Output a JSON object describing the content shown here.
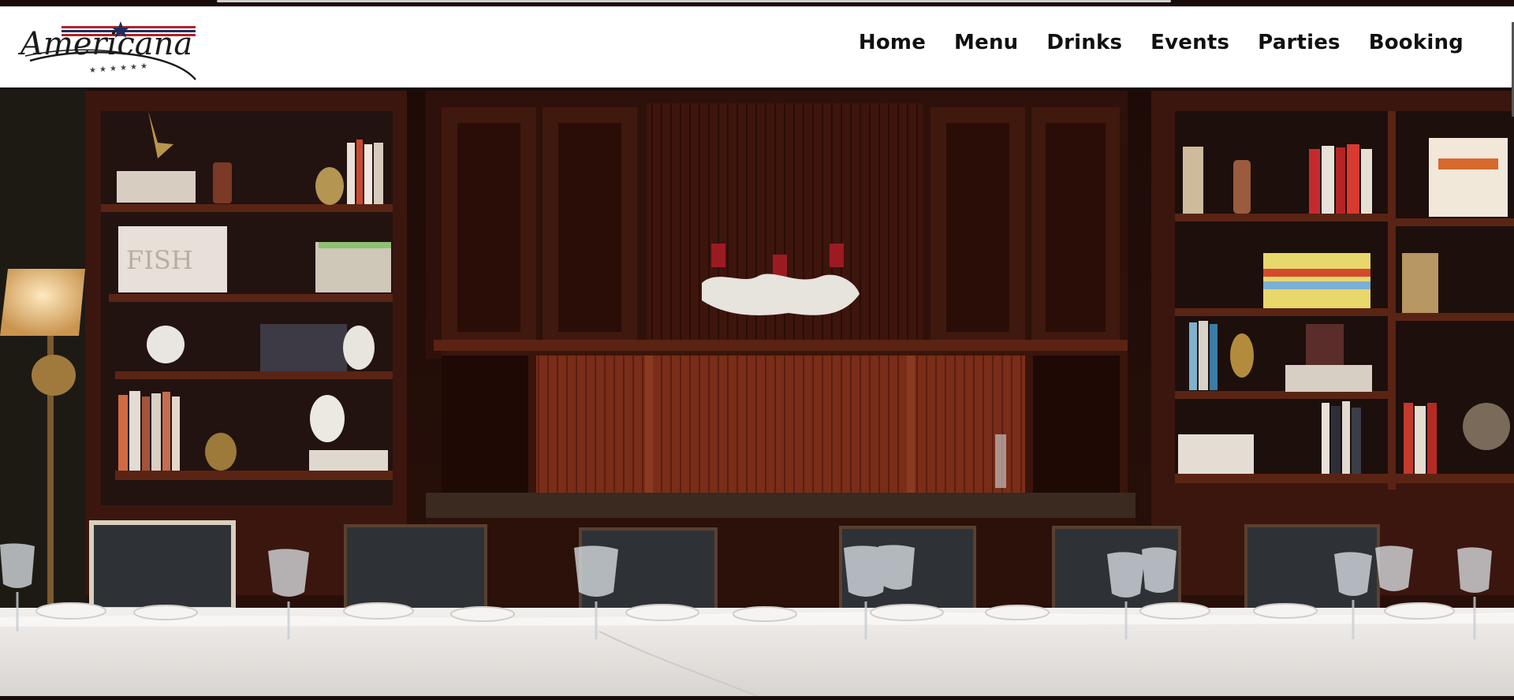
{
  "brand": {
    "name": "Americana",
    "logo_colors": {
      "stripe_red": "#b2222a",
      "stripe_blue": "#1f2d5c",
      "script": "#1b1b1b"
    }
  },
  "nav": {
    "items": [
      {
        "label": "Home"
      },
      {
        "label": "Menu"
      },
      {
        "label": "Drinks"
      },
      {
        "label": "Events"
      },
      {
        "label": "Parties"
      },
      {
        "label": "Booking"
      }
    ]
  },
  "hero": {
    "icon": "private-dining-room-photo",
    "palette": {
      "wood_dark": "#2a100a",
      "wood_mid": "#4a1c12",
      "wood_warm": "#6e2a18",
      "linen": "#e9e6e3",
      "glass": "#cfd5da"
    }
  }
}
